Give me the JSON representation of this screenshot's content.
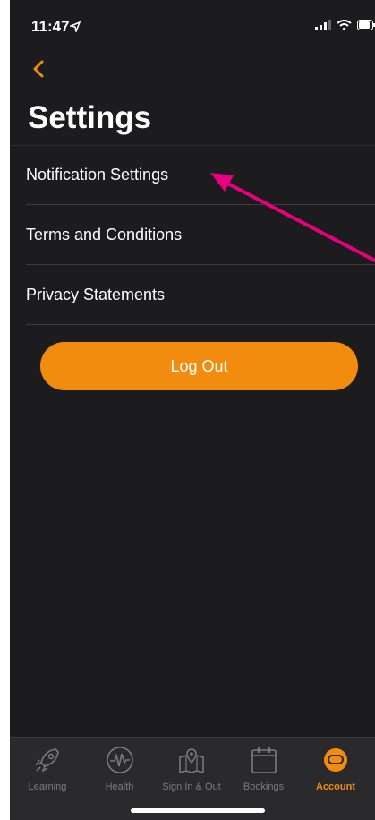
{
  "status_bar": {
    "time": "11:47"
  },
  "header": {
    "title": "Settings"
  },
  "settings_items": [
    {
      "label": "Notification Settings"
    },
    {
      "label": "Terms and Conditions"
    },
    {
      "label": "Privacy Statements"
    }
  ],
  "logout": {
    "label": "Log Out"
  },
  "tab_bar": {
    "tabs": [
      {
        "label": "Learning",
        "icon": "rocket-icon"
      },
      {
        "label": "Health",
        "icon": "heartbeat-icon"
      },
      {
        "label": "Sign In & Out",
        "icon": "map-pin-icon"
      },
      {
        "label": "Bookings",
        "icon": "calendar-icon"
      },
      {
        "label": "Account",
        "icon": "helmet-icon",
        "active": true
      }
    ]
  },
  "colors": {
    "accent": "#f28c0f",
    "background": "#1c1c1e",
    "annotation_arrow": "#e6007e"
  }
}
